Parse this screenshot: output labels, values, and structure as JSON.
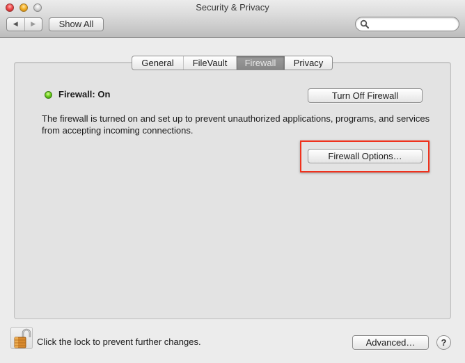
{
  "window": {
    "title": "Security & Privacy"
  },
  "toolbar": {
    "back_label": "◀",
    "forward_label": "▶",
    "show_all_label": "Show All",
    "search": {
      "value": "",
      "placeholder": ""
    }
  },
  "tabs": [
    {
      "label": "General",
      "active": false
    },
    {
      "label": "FileVault",
      "active": false
    },
    {
      "label": "Firewall",
      "active": true
    },
    {
      "label": "Privacy",
      "active": false
    }
  ],
  "firewall": {
    "status_label": "Firewall: On",
    "status_color": "#5cc516",
    "turn_off_label": "Turn Off Firewall",
    "description": "The firewall is turned on and set up to prevent unauthorized applications, programs, and services from accepting incoming connections.",
    "options_label": "Firewall Options…",
    "highlight_color": "#f0311c"
  },
  "footer": {
    "lock_label": "Click the lock to prevent further changes.",
    "advanced_label": "Advanced…",
    "help_label": "?"
  }
}
